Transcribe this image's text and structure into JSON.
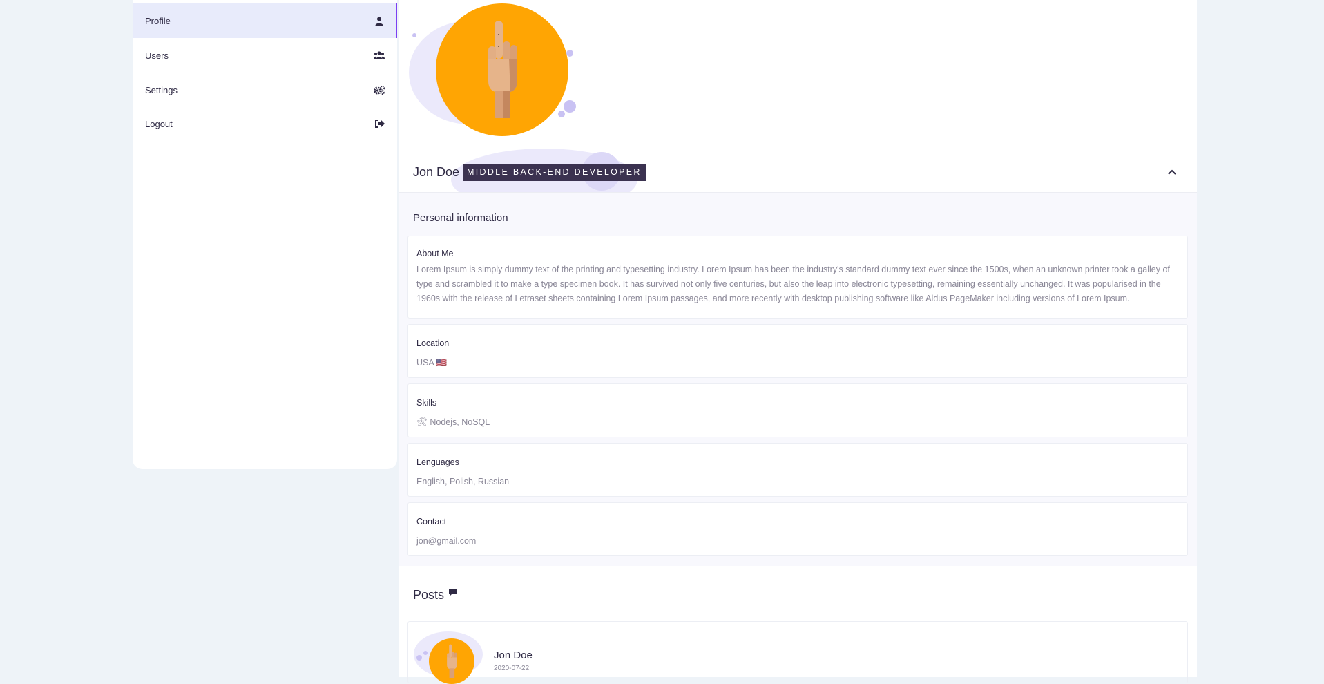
{
  "sidebar": {
    "items": [
      {
        "label": "Profile",
        "icon": "user-icon",
        "active": true
      },
      {
        "label": "Users",
        "icon": "users-icon",
        "active": false
      },
      {
        "label": "Settings",
        "icon": "cogs-icon",
        "active": false
      },
      {
        "label": "Logout",
        "icon": "logout-icon",
        "active": false
      }
    ]
  },
  "profile": {
    "name": "Jon Doe",
    "role": "MIDDLE BACK-END DEVELOPER",
    "avatar_icon": "wooden-hand-icon",
    "section_title": "Personal information",
    "fields": [
      {
        "label": "About Me",
        "value": "Lorem Ipsum is simply dummy text of the printing and typesetting industry. Lorem Ipsum has been the industry's standard dummy text ever since the 1500s, when an unknown printer took a galley of type and scrambled it to make a type specimen book. It has survived not only five centuries, but also the leap into electronic typesetting, remaining essentially unchanged. It was popularised in the 1960s with the release of Letraset sheets containing Lorem Ipsum passages, and more recently with desktop publishing software like Aldus PageMaker including versions of Lorem Ipsum."
      },
      {
        "label": "Location",
        "value": "USA 🇺🇸"
      },
      {
        "label": "Skills",
        "value": "🛠 Nodejs, NoSQL"
      },
      {
        "label": "Lenguages",
        "value": "English, Polish, Russian"
      },
      {
        "label": "Contact",
        "value": "jon@gmail.com"
      }
    ]
  },
  "posts": {
    "title": "Posts",
    "items": [
      {
        "author": "Jon Doe",
        "date": "2020-07-22"
      }
    ]
  },
  "colors": {
    "accent": "#7b3ff2",
    "avatar_bg": "#ffa503",
    "badge_bg": "#3b3250",
    "page_bg": "#eef3f8"
  }
}
